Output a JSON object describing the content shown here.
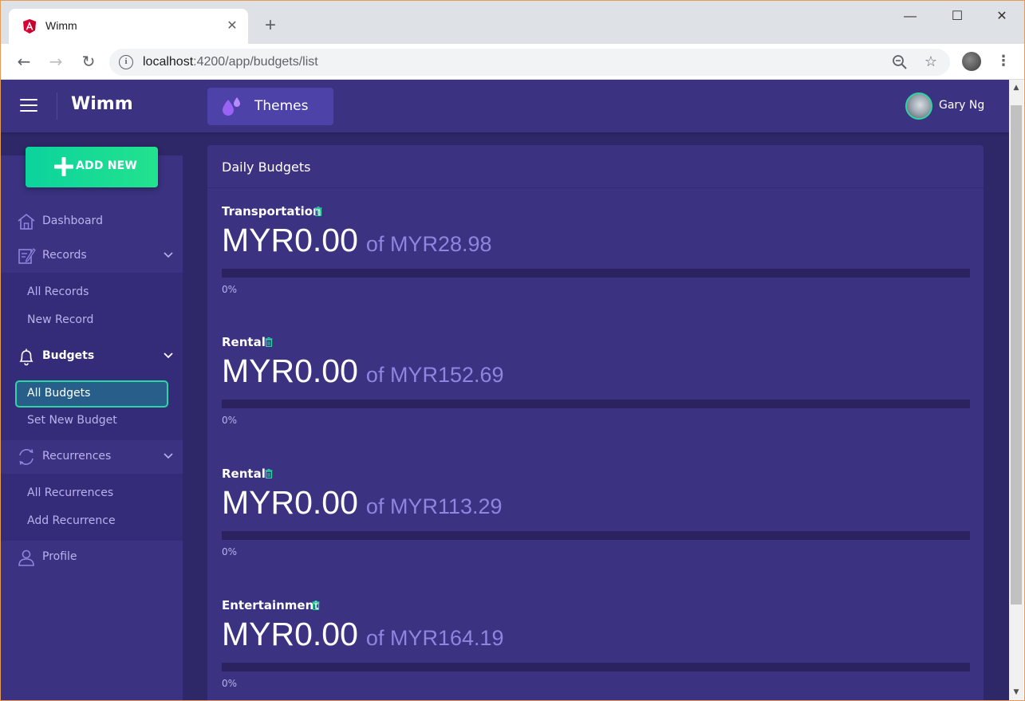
{
  "browser": {
    "tab_title": "Wimm",
    "url_host": "localhost",
    "url_path": ":4200/app/budgets/list",
    "window_controls": {
      "minimize": "—",
      "maximize": "☐",
      "close": "✕"
    }
  },
  "header": {
    "brand": "Wimm",
    "themes_label": "Themes",
    "user_name": "Gary Ng"
  },
  "sidebar": {
    "add_new_label": "ADD NEW",
    "dashboard": "Dashboard",
    "records": {
      "label": "Records",
      "items": [
        "All Records",
        "New Record"
      ]
    },
    "budgets": {
      "label": "Budgets",
      "items": [
        "All Budgets",
        "Set New Budget"
      ],
      "active_item": "All Budgets"
    },
    "recurrences": {
      "label": "Recurrences",
      "items": [
        "All Recurrences",
        "Add Recurrence"
      ]
    },
    "profile": "Profile"
  },
  "main": {
    "card_title": "Daily Budgets",
    "budgets": [
      {
        "name": "Transportation",
        "amount": "MYR0.00",
        "limit": "of MYR28.98",
        "progress_label": "0%",
        "progress": 0
      },
      {
        "name": "Rental",
        "amount": "MYR0.00",
        "limit": "of MYR152.69",
        "progress_label": "0%",
        "progress": 0
      },
      {
        "name": "Rental",
        "amount": "MYR0.00",
        "limit": "of MYR113.29",
        "progress_label": "0%",
        "progress": 0
      },
      {
        "name": "Entertainment",
        "amount": "MYR0.00",
        "limit": "of MYR164.19",
        "progress_label": "0%",
        "progress": 0
      }
    ]
  },
  "colors": {
    "app_background": "#2f2868",
    "panel": "#3b3281",
    "accent_green": "#2bd6a0",
    "muted_text": "#b9b3ec",
    "limit_text": "#8e85e0"
  }
}
